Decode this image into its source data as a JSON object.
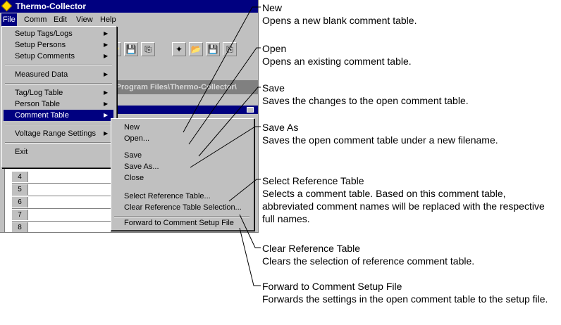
{
  "window": {
    "title": "Thermo-Collector",
    "path_text": "C:\\Program Files\\Thermo-Collector\\"
  },
  "menubar": [
    "File",
    "Comm",
    "Edit",
    "View",
    "Help"
  ],
  "file_menu": [
    "Setup Tags/Logs",
    "Setup Persons",
    "Setup Comments",
    "Measured Data",
    "Tag/Log Table",
    "Person Table",
    "Comment Table",
    "Voltage Range Settings",
    "Exit"
  ],
  "comment_table_menu": [
    "New",
    "Open...",
    "Save",
    "Save As...",
    "Close",
    "Select Reference Table...",
    "Clear Reference Table Selection...",
    "Forward to Comment Setup File"
  ],
  "grid_rows": [
    "4",
    "5",
    "6",
    "7",
    "8"
  ],
  "callouts": [
    {
      "title": "New",
      "desc": "Opens a new blank comment table."
    },
    {
      "title": "Open",
      "desc": "Opens an existing comment table."
    },
    {
      "title": "Save",
      "desc": "Saves the changes to the open comment table."
    },
    {
      "title": "Save As",
      "desc": "Saves the open comment table under a new filename."
    },
    {
      "title": "Select Reference Table",
      "desc": "Selects a comment table.  Based on this comment table, abbreviated comment names will be replaced with the respective full names."
    },
    {
      "title": "Clear Reference Table",
      "desc": "Clears the selection of reference comment table."
    },
    {
      "title": "Forward to Comment Setup File",
      "desc": "Forwards the settings in the open comment table to the setup file."
    }
  ]
}
